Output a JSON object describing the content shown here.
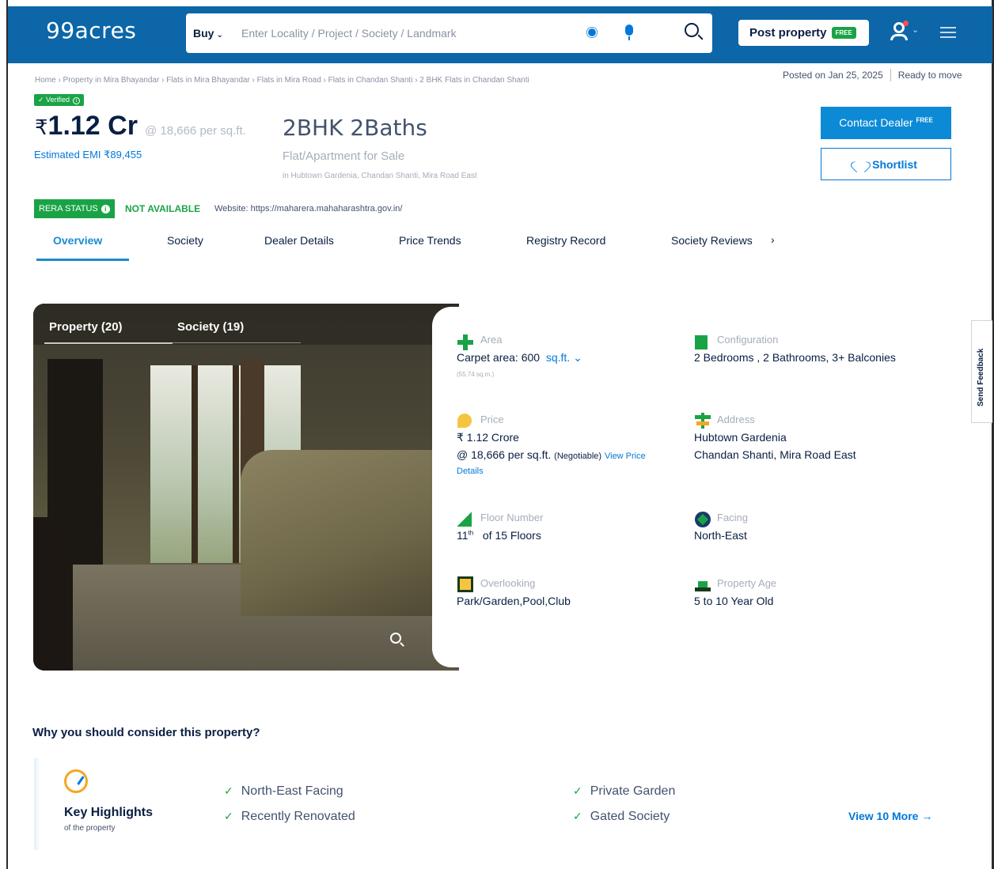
{
  "header": {
    "logo": "99acres",
    "search_type": "Buy",
    "search_placeholder": "Enter Locality / Project / Society / Landmark",
    "post_property": "Post property",
    "post_badge": "FREE"
  },
  "breadcrumb": "Home › Property in Mira Bhayandar › Flats in Mira Bhayandar › Flats in Mira Road › Flats in Chandan Shanti › 2 BHK Flats in Chandan Shanti",
  "posted": "Posted on Jan 25, 2025",
  "status": "Ready to move",
  "listing": {
    "verified": "Verified",
    "price_symbol": "₹",
    "price": "1.12 Cr",
    "price_per_sqft": "@ 18,666 per sq.ft.",
    "emi": "Estimated EMI ₹89,455",
    "title": "2BHK 2Baths",
    "type": "Flat/Apartment for Sale",
    "location": "in Hubtown Gardenia, Chandan Shanti, Mira Road East"
  },
  "actions": {
    "contact": "Contact Dealer",
    "contact_badge": "FREE",
    "shortlist": "Shortlist"
  },
  "rera": {
    "label": "RERA STATUS",
    "value": "NOT AVAILABLE",
    "website": "Website: https://maharera.mahaharashtra.gov.in/"
  },
  "tabs": [
    "Overview",
    "Society",
    "Dealer Details",
    "Price Trends",
    "Registry Record",
    "Society Reviews"
  ],
  "gallery": {
    "tab1": "Property (20)",
    "tab2": "Society (19)"
  },
  "details": {
    "area_label": "Area",
    "area_value": "Carpet area: 600",
    "area_unit": "sq.ft.",
    "area_sub": "(55.74 sq.m.)",
    "config_label": "Configuration",
    "config_value": "2 Bedrooms , 2 Bathrooms, 3+ Balconies",
    "price_label": "Price",
    "price_value": "₹ 1.12 Crore",
    "price_psf": "@ 18,666 per sq.ft.",
    "price_negotiable": "(Negotiable)",
    "price_link_1": "View Price",
    "price_link_2": "Details",
    "address_label": "Address",
    "address_line1": "Hubtown Gardenia",
    "address_line2": "Chandan Shanti, Mira Road East",
    "floor_label": "Floor Number",
    "floor_num": "11",
    "floor_sup": "th",
    "floor_rest": "of 15 Floors",
    "facing_label": "Facing",
    "facing_value": "North-East",
    "overlooking_label": "Overlooking",
    "overlooking_value": "Park/Garden,Pool,Club",
    "age_label": "Property Age",
    "age_value": "5 to 10 Year Old"
  },
  "feedback": "Send Feedback",
  "why": {
    "title": "Why you should consider this property?",
    "box_title": "Key Highlights",
    "box_sub": "of the property",
    "items": [
      "North-East Facing",
      "Recently Renovated",
      "Private Garden",
      "Gated Society"
    ],
    "more": "View 10 More →"
  },
  "colors": {
    "header_blue": "#0c66a8",
    "link_blue": "#0078db",
    "green": "#1aa346"
  }
}
